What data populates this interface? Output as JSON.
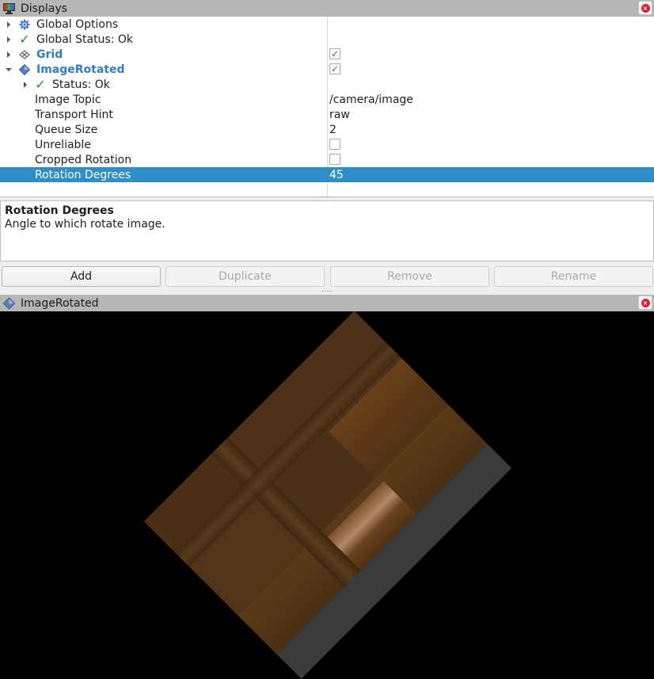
{
  "displays_panel": {
    "title": "Displays",
    "title_icon": "monitor-icon",
    "close_icon": "close-icon",
    "tree": [
      {
        "label": "Global Options",
        "icon": "gear-icon",
        "expander": "collapsed",
        "indent": 0,
        "value": null
      },
      {
        "label": "Global Status: Ok",
        "icon": "check-icon",
        "expander": "collapsed",
        "indent": 0,
        "value": null
      },
      {
        "label": "Grid",
        "icon": "grid-icon",
        "expander": "collapsed",
        "indent": 0,
        "value": "checked",
        "style": "display"
      },
      {
        "label": "ImageRotated",
        "icon": "image-display-icon",
        "expander": "expanded",
        "indent": 0,
        "value": "checked",
        "style": "display"
      },
      {
        "label": "Status: Ok",
        "icon": "check-icon",
        "expander": "collapsed",
        "indent": 1,
        "value": null
      },
      {
        "label": "Image Topic",
        "indent": 1,
        "value": "/camera/image"
      },
      {
        "label": "Transport Hint",
        "indent": 1,
        "value": "raw"
      },
      {
        "label": "Queue Size",
        "indent": 1,
        "value": "2"
      },
      {
        "label": "Unreliable",
        "indent": 1,
        "value": "unchecked"
      },
      {
        "label": "Cropped Rotation",
        "indent": 1,
        "value": "unchecked"
      },
      {
        "label": "Rotation Degrees",
        "indent": 1,
        "value": "45",
        "selected": true
      }
    ],
    "description": {
      "title": "Rotation Degrees",
      "text": "Angle to which rotate image."
    },
    "buttons": [
      {
        "label": "Add",
        "enabled": true
      },
      {
        "label": "Duplicate",
        "enabled": false
      },
      {
        "label": "Remove",
        "enabled": false
      },
      {
        "label": "Rename",
        "enabled": false
      }
    ]
  },
  "image_panel": {
    "title": "ImageRotated",
    "title_icon": "image-display-icon",
    "close_icon": "close-icon",
    "rotation_degrees": 45
  },
  "colors": {
    "selection": "#2f8dc8",
    "display_name": "#2f7dc6",
    "status_ok": "#2a8a2a",
    "close": "#d91e36"
  }
}
